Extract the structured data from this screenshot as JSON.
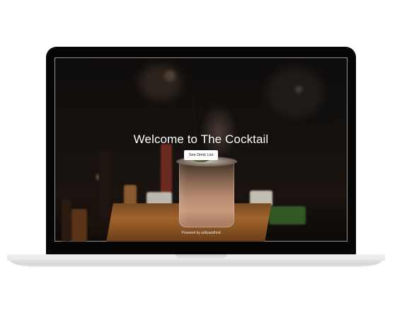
{
  "hero": {
    "title": "Welcome to The Cocktail",
    "button_label": "See Drink List"
  },
  "footer": {
    "powered_text": "Powered by adityandhnd"
  },
  "colors": {
    "device_frame": "#050505",
    "device_base": "#e6e6e6",
    "hero_text": "#ffffff",
    "button_bg": "#ffffff"
  }
}
